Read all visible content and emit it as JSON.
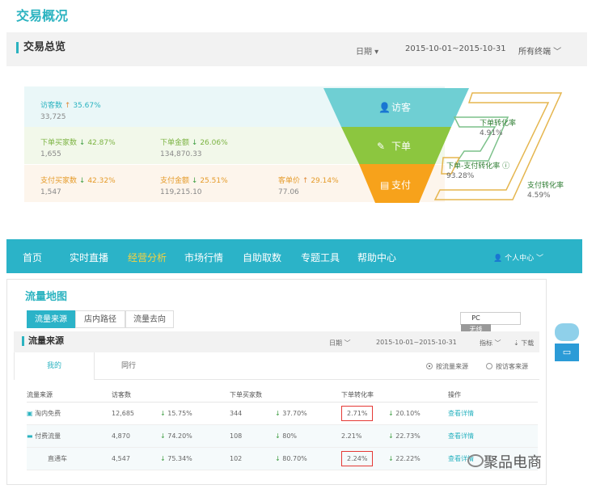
{
  "header": {
    "title": "交易概况"
  },
  "overview": {
    "label": "交易总览",
    "date_label": "日期",
    "date_range": "2015-10-01~2015-10-31",
    "terminal": "所有终端"
  },
  "metrics": {
    "visitors": {
      "label": "访客数",
      "change": "35.67%",
      "value": "33,725"
    },
    "order_buyers": {
      "label": "下单买家数",
      "change": "42.87%",
      "value": "1,655"
    },
    "order_amount": {
      "label": "下单金额",
      "change": "26.06%",
      "value": "134,870.33"
    },
    "pay_buyers": {
      "label": "支付买家数",
      "change": "42.32%",
      "value": "1,547"
    },
    "pay_amount": {
      "label": "支付金额",
      "change": "25.51%",
      "value": "119,215.10"
    },
    "unit_price": {
      "label": "客单价",
      "change": "29.14%",
      "value": "77.06"
    }
  },
  "funnel": {
    "stages": [
      "访客",
      "下单",
      "支付"
    ],
    "order_rate_label": "下单转化率",
    "order_rate": "4.91%",
    "order_pay_label": "下单-支付转化率",
    "order_pay_rate": "93.28%",
    "pay_rate_label": "支付转化率",
    "pay_rate": "4.59%",
    "colors": {
      "visit": "#6fcfd3",
      "order": "#8cc63f",
      "pay": "#f7a21b"
    }
  },
  "nav": {
    "items": [
      "首页",
      "实时直播",
      "经营分析",
      "市场行情",
      "自助取数",
      "专题工具",
      "帮助中心"
    ],
    "user": "个人中心"
  },
  "flow": {
    "title": "流量地图",
    "tabs": [
      "流量来源",
      "店内路径",
      "流量去向"
    ],
    "toggle": [
      "PC",
      "无线"
    ],
    "section": "流量来源",
    "date_label": "日期",
    "date_range": "2015-10-01~2015-10-31",
    "metric_label": "指标",
    "download": "下载",
    "subtabs": [
      "我的",
      "同行"
    ],
    "radio1": "按流量来源",
    "radio2": "按访客来源",
    "columns": [
      "流量来源",
      "访客数",
      "",
      "下单买家数",
      "",
      "下单转化率",
      "",
      "操作"
    ],
    "rows": [
      {
        "source": "淘内免费",
        "visitors": "12,685",
        "v_change": "15.75%",
        "buyers": "344",
        "b_change": "37.70%",
        "rate": "2.71%",
        "r_change": "20.10%",
        "op": "查看详情"
      },
      {
        "source": "付费流量",
        "visitors": "4,870",
        "v_change": "74.20%",
        "buyers": "108",
        "b_change": "80%",
        "rate": "2.21%",
        "r_change": "22.73%",
        "op": "查看详情"
      },
      {
        "source": "直通车",
        "visitors": "4,547",
        "v_change": "75.34%",
        "buyers": "102",
        "b_change": "80.70%",
        "rate": "2.24%",
        "r_change": "22.22%",
        "op": "查看详情"
      }
    ]
  },
  "watermark": "聚品电商"
}
